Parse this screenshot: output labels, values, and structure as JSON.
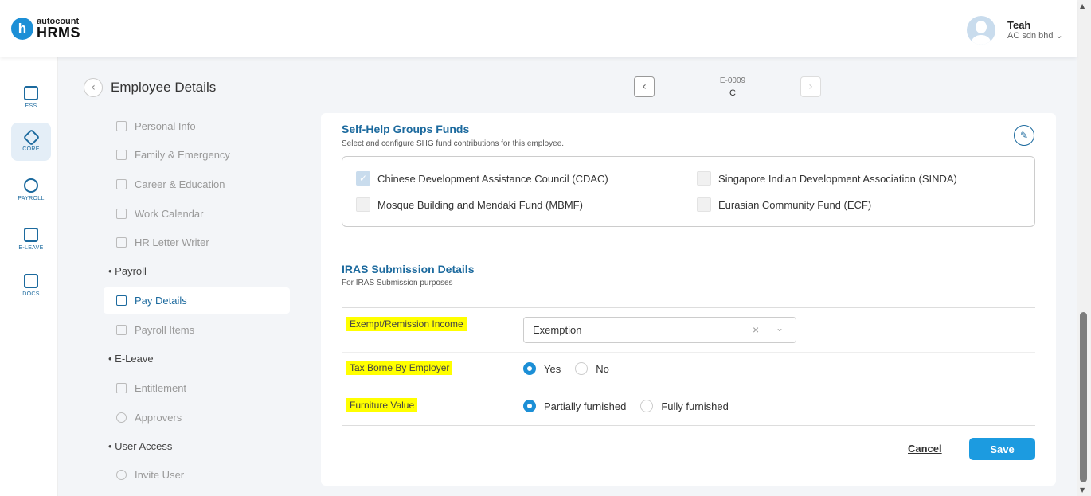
{
  "header": {
    "logo_mark": "h",
    "logo_small": "autocount",
    "logo_big": "HRMS",
    "user_name": "Teah",
    "user_company": "AC sdn bhd ⌄"
  },
  "rail": [
    {
      "label": "ESS",
      "icon": "ess-icon"
    },
    {
      "label": "CORE",
      "icon": "cube-icon"
    },
    {
      "label": "PAYROLL",
      "icon": "dollar-icon"
    },
    {
      "label": "E-LEAVE",
      "icon": "calendar-icon"
    },
    {
      "label": "DOCS",
      "icon": "document-icon"
    }
  ],
  "page": {
    "title": "Employee Details",
    "emp_code": "E-0009",
    "emp_name": "C"
  },
  "menu": {
    "items": [
      {
        "label": "Personal Info"
      },
      {
        "label": "Family & Emergency"
      },
      {
        "label": "Career & Education"
      },
      {
        "label": "Work Calendar"
      },
      {
        "label": "HR Letter Writer"
      },
      {
        "label": "Pay Details"
      },
      {
        "label": "Payroll Items"
      },
      {
        "label": "Entitlement"
      },
      {
        "label": "Approvers"
      },
      {
        "label": "Invite User"
      }
    ],
    "sections": [
      "• Payroll",
      "• E-Leave",
      "• User Access"
    ]
  },
  "shg": {
    "title": "Self-Help Groups Funds",
    "subtitle": "Select and configure SHG fund contributions for this employee.",
    "options": [
      {
        "label": "Chinese Development Assistance Council (CDAC)",
        "checked": true
      },
      {
        "label": "Singapore Indian Development Association (SINDA)",
        "checked": false
      },
      {
        "label": "Mosque Building and Mendaki Fund (MBMF)",
        "checked": false
      },
      {
        "label": "Eurasian Community Fund (ECF)",
        "checked": false
      }
    ]
  },
  "iras": {
    "title": "IRAS Submission Details",
    "subtitle": "For IRAS Submission purposes",
    "exempt_label": "Exempt/Remission Income",
    "exempt_value": "Exemption",
    "tax_label": "Tax Borne By Employer",
    "tax_options": [
      "Yes",
      "No"
    ],
    "tax_selected": "Yes",
    "furniture_label": "Furniture Value",
    "furniture_options": [
      "Partially furnished",
      "Fully furnished"
    ],
    "furniture_selected": "Partially furnished"
  },
  "actions": {
    "cancel": "Cancel",
    "save": "Save"
  },
  "colors": {
    "accent": "#1c6a9e",
    "primary_button": "#1c9be0",
    "highlight": "#ffff00"
  }
}
